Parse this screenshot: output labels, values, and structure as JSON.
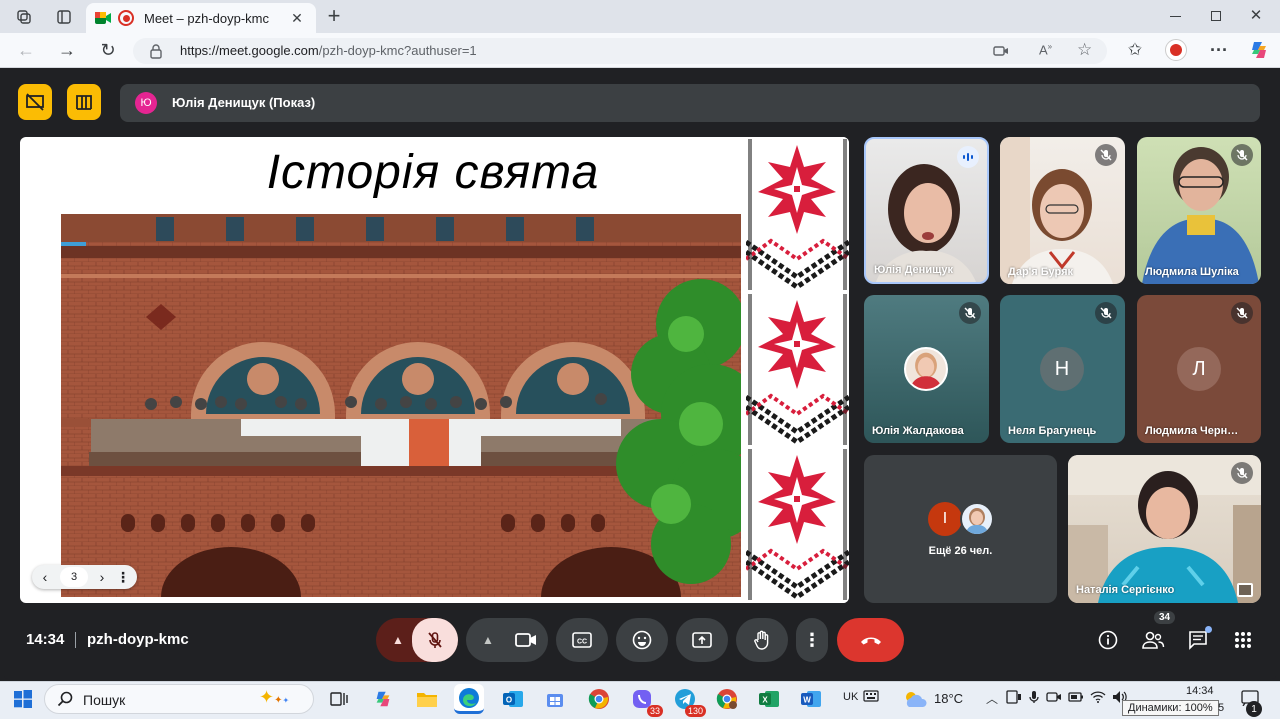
{
  "browser": {
    "tab_title": "Meet – pzh-doyp-kmc",
    "url_host": "https://meet.google.com",
    "url_path": "/pzh-doyp-kmc?authuser=1"
  },
  "presenter_bar": {
    "avatar_letter": "Ю",
    "label": "Юлія Денищук (Показ)"
  },
  "slide": {
    "title": "Історія свята",
    "page": "3"
  },
  "participants": [
    {
      "name": "Юлія Денищук",
      "speaking": true
    },
    {
      "name": "Дар'я Буряк",
      "muted": true
    },
    {
      "name": "Людмила Шуліка",
      "muted": true
    },
    {
      "name": "Юлія Жалдакова",
      "muted": true
    },
    {
      "name": "Неля Брагунець",
      "letter": "Н",
      "muted": true
    },
    {
      "name": "Людмила Черн…",
      "letter": "Л",
      "muted": true
    },
    {
      "name": "Наталія Сергієнко",
      "muted": true
    }
  ],
  "others": {
    "letter": "І",
    "label": "Ещё 26 чел."
  },
  "meeting": {
    "time": "14:34",
    "code": "pzh-doyp-kmc",
    "people_count": "34"
  },
  "taskbar": {
    "search_placeholder": "Пошук",
    "lang": "UK",
    "temp": "18°C",
    "clock_time": "14:34",
    "tooltip": "Динамики: 100%",
    "clock_tail": "5",
    "notif_count": "1",
    "viber_badge": "33",
    "telegram_badge": "130"
  },
  "colors": {
    "accent_yellow": "#fbbc04",
    "end_call": "#ea4335",
    "mic_off": "#f9dedc",
    "meet_bg": "#202124"
  }
}
